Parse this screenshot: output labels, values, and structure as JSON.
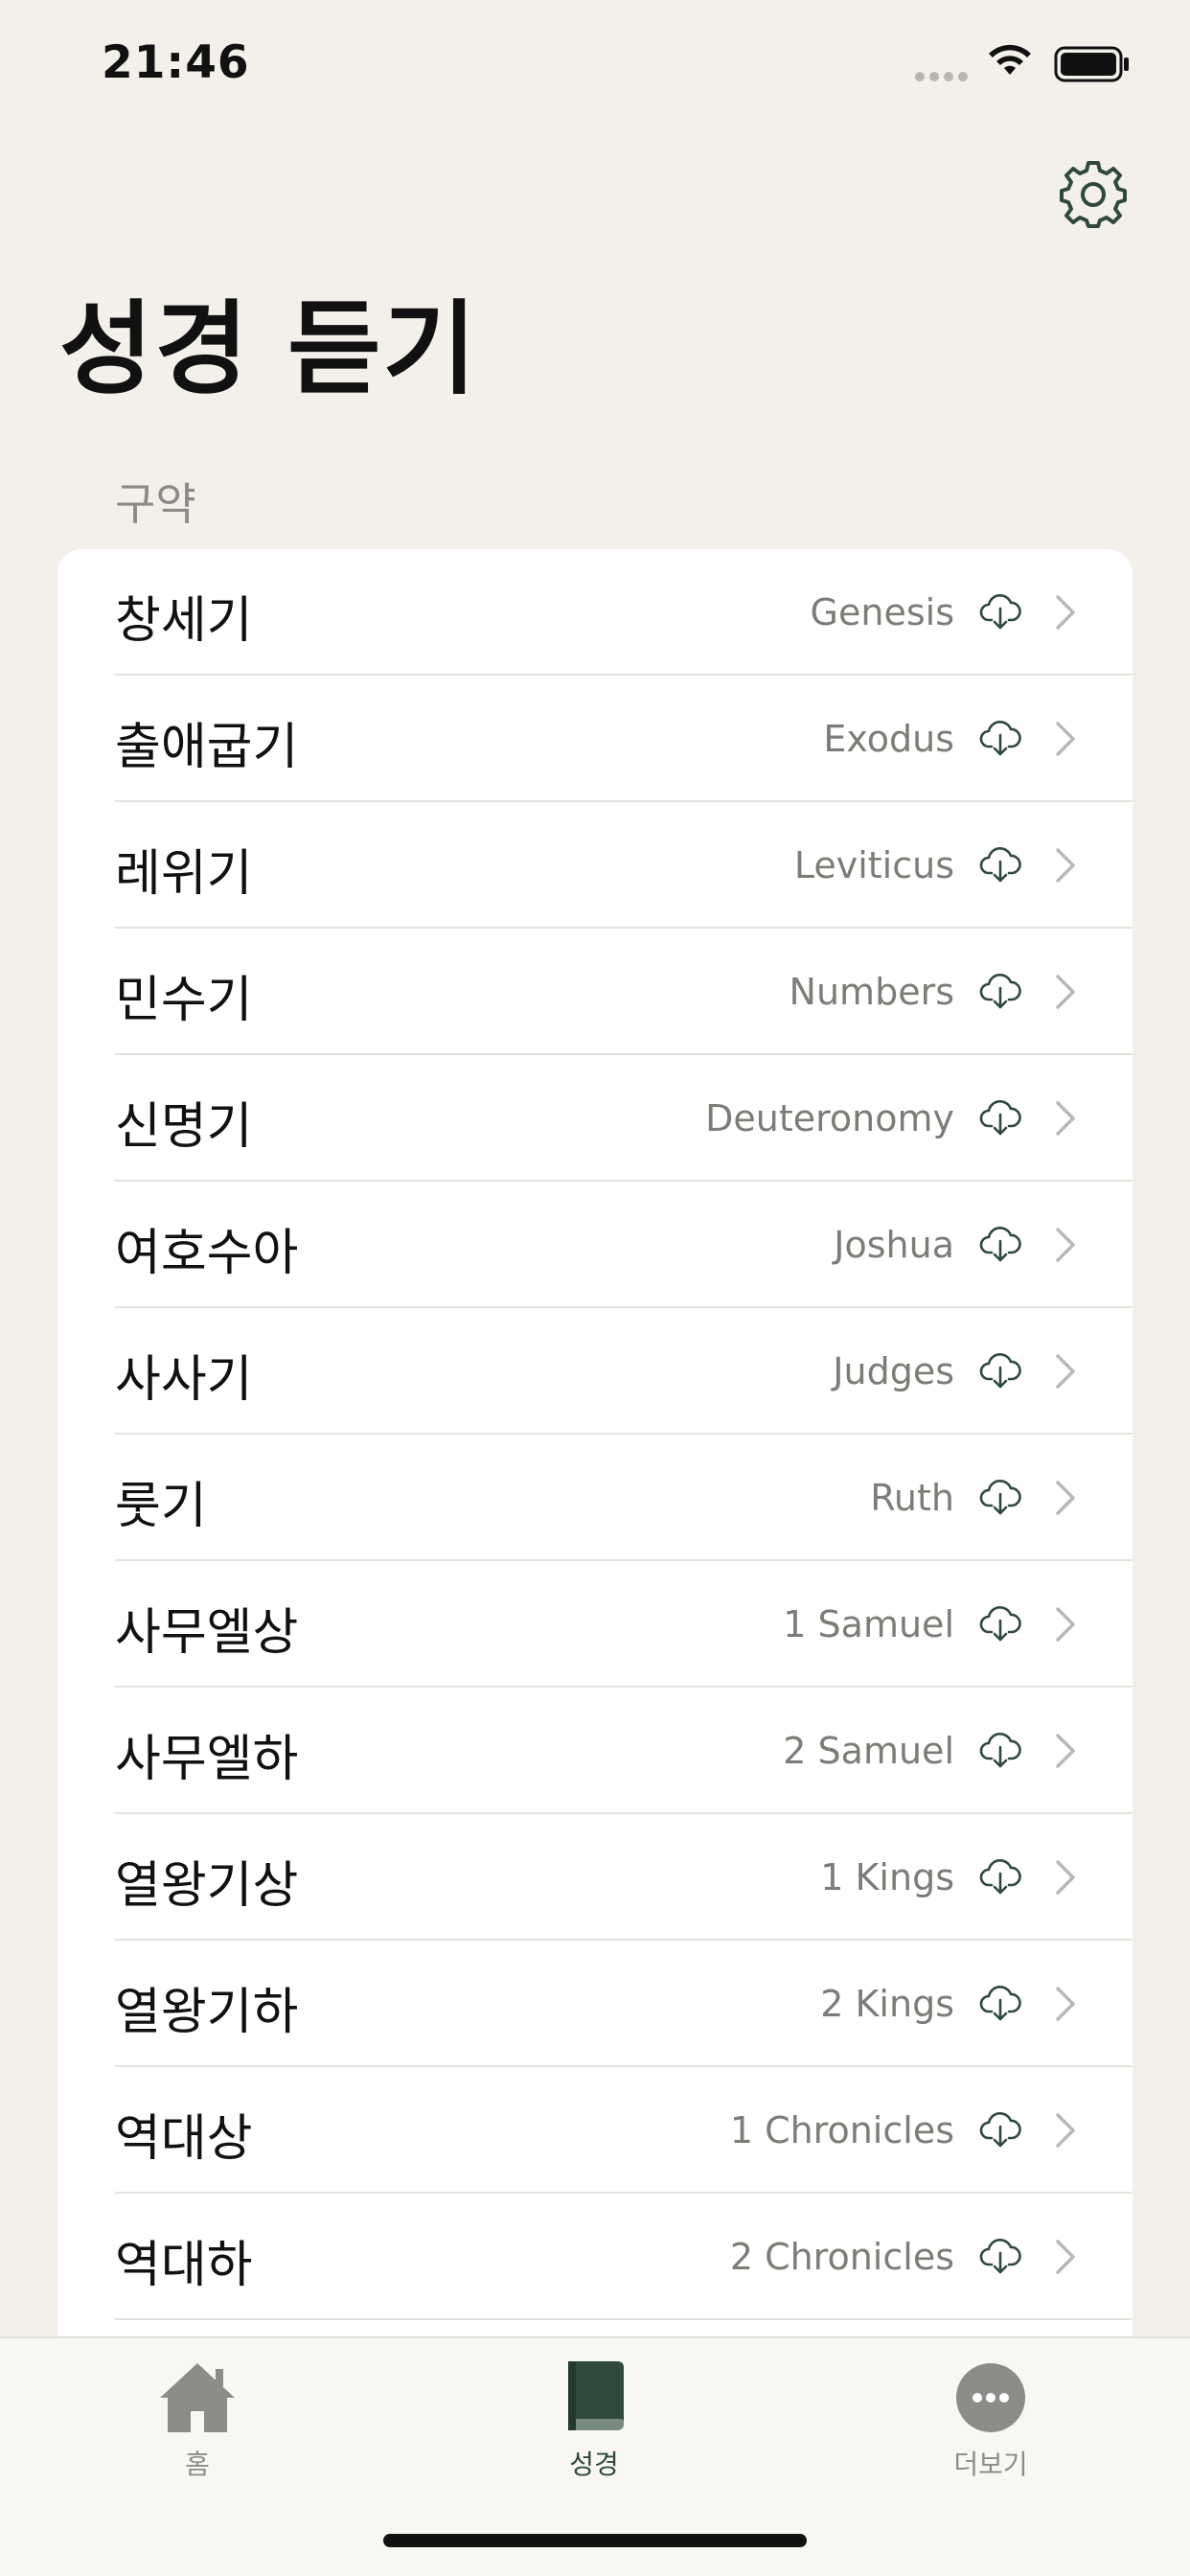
{
  "status_bar": {
    "time": "21:46"
  },
  "header": {
    "title": "성경 듣기",
    "settings_icon": "gear-icon"
  },
  "section": {
    "title": "구약"
  },
  "books": [
    {
      "korean": "창세기",
      "english": "Genesis"
    },
    {
      "korean": "출애굽기",
      "english": "Exodus"
    },
    {
      "korean": "레위기",
      "english": "Leviticus"
    },
    {
      "korean": "민수기",
      "english": "Numbers"
    },
    {
      "korean": "신명기",
      "english": "Deuteronomy"
    },
    {
      "korean": "여호수아",
      "english": "Joshua"
    },
    {
      "korean": "사사기",
      "english": "Judges"
    },
    {
      "korean": "룻기",
      "english": "Ruth"
    },
    {
      "korean": "사무엘상",
      "english": "1 Samuel"
    },
    {
      "korean": "사무엘하",
      "english": "2 Samuel"
    },
    {
      "korean": "열왕기상",
      "english": "1 Kings"
    },
    {
      "korean": "열왕기하",
      "english": "2 Kings"
    },
    {
      "korean": "역대상",
      "english": "1 Chronicles"
    },
    {
      "korean": "역대하",
      "english": "2 Chronicles"
    }
  ],
  "row_icons": {
    "download": "cloud-download-icon",
    "chevron": "chevron-right-icon"
  },
  "tab_bar": {
    "tabs": [
      {
        "label": "홈",
        "icon": "home-icon",
        "active": false
      },
      {
        "label": "성경",
        "icon": "book-icon",
        "active": true
      },
      {
        "label": "더보기",
        "icon": "more-icon",
        "active": false
      }
    ]
  },
  "colors": {
    "background": "#f3f0ea",
    "card": "#ffffff",
    "accent": "#2f4a3c",
    "secondary_text": "#7e7c77",
    "inactive_tab": "#8d8c88"
  }
}
